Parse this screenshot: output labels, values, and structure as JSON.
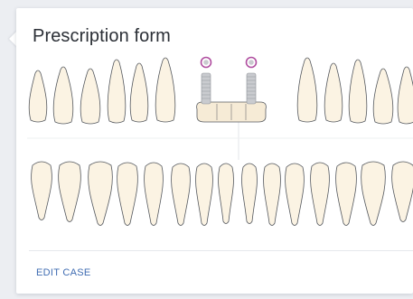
{
  "card": {
    "title": "Prescription form",
    "edit_label": "EDIT CASE"
  },
  "colors": {
    "tooth_fill": "#fbf3e3",
    "tooth_stroke": "#55595f",
    "implant_metal": "#c9cbcf",
    "implant_ring": "#b04fa0",
    "crown_fill": "#f6ebd6",
    "link": "#3f6cb2",
    "divider": "#e6e8ec"
  },
  "dental_chart": {
    "upper_arch": {
      "implants": [
        "implant",
        "implant"
      ],
      "bridge": "crown-bridge"
    },
    "lower_arch": {}
  }
}
